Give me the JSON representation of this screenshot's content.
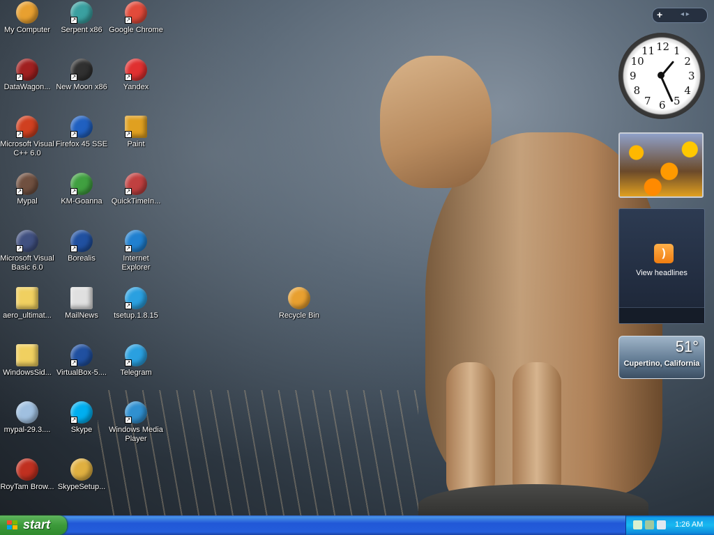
{
  "desktop": {
    "icons": [
      {
        "label": "My Computer",
        "icon": "garfield-computer-icon",
        "color": "#e8a030"
      },
      {
        "label": "Serpent x86",
        "icon": "serpent-browser-icon",
        "color": "#3aa0a0"
      },
      {
        "label": "Google Chrome",
        "icon": "chrome-icon",
        "color": "#e24a3a"
      },
      {
        "label": "DataWagon...",
        "icon": "datawagon-icon",
        "color": "#a02020"
      },
      {
        "label": "New Moon x86",
        "icon": "new-moon-icon",
        "color": "#303030"
      },
      {
        "label": "Yandex",
        "icon": "yandex-icon",
        "color": "#e03030"
      },
      {
        "label": "Microsoft Visual C++ 6.0",
        "icon": "visual-cpp-icon",
        "color": "#d04020"
      },
      {
        "label": "Firefox 45 SSE",
        "icon": "firefox-icon",
        "color": "#2060c0"
      },
      {
        "label": "Paint",
        "icon": "paint-icon",
        "color": "#e0a020"
      },
      {
        "label": "Mypal",
        "icon": "mypal-raccoon-icon",
        "color": "#705040"
      },
      {
        "label": "KM-Goanna",
        "icon": "km-goanna-icon",
        "color": "#40a040"
      },
      {
        "label": "QuickTimeIn...",
        "icon": "quicktime-installer-icon",
        "color": "#c04040"
      },
      {
        "label": "Microsoft Visual Basic 6.0",
        "icon": "visual-basic-icon",
        "color": "#405080"
      },
      {
        "label": "Borealis",
        "icon": "borealis-icon",
        "color": "#2050a0"
      },
      {
        "label": "Internet Explorer",
        "icon": "internet-explorer-icon",
        "color": "#2080d0"
      },
      {
        "label": "aero_ultimat...",
        "icon": "folder-icon",
        "color": "#f0d060"
      },
      {
        "label": "MailNews",
        "icon": "mail-envelope-icon",
        "color": "#e0e0e0"
      },
      {
        "label": "tsetup.1.8.15",
        "icon": "telegram-icon",
        "color": "#2aa0e0"
      },
      {
        "label": "Recycle Bin",
        "icon": "garfield-recycle-bin-icon",
        "color": "#e8a030"
      },
      {
        "label": "WindowsSid...",
        "icon": "folder-icon",
        "color": "#f0d060"
      },
      {
        "label": "VirtualBox-5....",
        "icon": "virtualbox-icon",
        "color": "#2050a0"
      },
      {
        "label": "Telegram",
        "icon": "telegram-icon",
        "color": "#2aa0e0"
      },
      {
        "label": "mypal-29.3....",
        "icon": "installer-cd-icon",
        "color": "#a0c0e0"
      },
      {
        "label": "Skype",
        "icon": "skype-icon",
        "color": "#00aff0"
      },
      {
        "label": "Windows Media Player",
        "icon": "media-player-icon",
        "color": "#3090d0"
      },
      {
        "label": "RoyTam Brow...",
        "icon": "roytam-browser-icon",
        "color": "#c03020"
      },
      {
        "label": "SkypeSetup...",
        "icon": "skype-setup-icon",
        "color": "#e0b040"
      }
    ]
  },
  "gadgets": {
    "toolbar_plus": "+",
    "toolbar_nav": "◂ ▸",
    "clock_numbers": [
      "12",
      "1",
      "2",
      "3",
      "4",
      "5",
      "6",
      "7",
      "8",
      "9",
      "10",
      "11"
    ],
    "feed_label": "View headlines",
    "feed_icon": "rss-icon",
    "weather_temp": "51°",
    "weather_city": "Cupertino, California"
  },
  "taskbar": {
    "start_label": "start",
    "time": "1:26 AM",
    "tray_icons": [
      "network-icon",
      "display-icon",
      "update-icon"
    ]
  }
}
